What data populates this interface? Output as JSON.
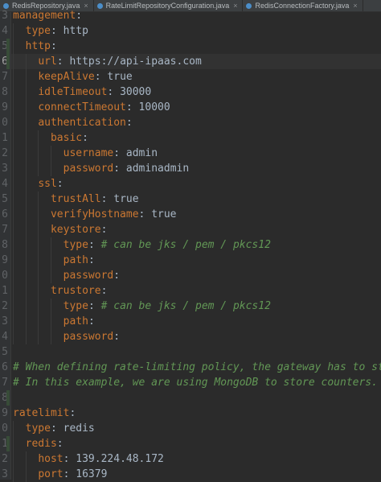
{
  "tabs": [
    {
      "label": "RedisRepository.java",
      "icon": "java-class-icon",
      "icon_color": "#4b8ec9"
    },
    {
      "label": "RateLimitRepositoryConfiguration.java",
      "icon": "java-class-icon",
      "icon_color": "#4b8ec9"
    },
    {
      "label": "RedisConnectionFactory.java",
      "icon": "java-class-icon",
      "icon_color": "#4b8ec9"
    }
  ],
  "gutter": {
    "line_numbers": [
      "3",
      "4",
      "5",
      "6",
      "7",
      "8",
      "9",
      "0",
      "1",
      "2",
      "3",
      "4",
      "5",
      "6",
      "7",
      "8",
      "9",
      "0",
      "1",
      "2",
      "3",
      "4",
      "5",
      "6",
      "7",
      "8",
      "9",
      "0",
      "1",
      "2",
      "3"
    ]
  },
  "code": {
    "lines": [
      {
        "key": "management",
        "sep": ":",
        "value": "",
        "comment": ""
      },
      {
        "key": "type",
        "sep": ": ",
        "value": "http",
        "comment": ""
      },
      {
        "key": "http",
        "sep": ":",
        "value": "",
        "comment": ""
      },
      {
        "key": "url",
        "sep": ": ",
        "value": "https://api-ipaas.com",
        "comment": ""
      },
      {
        "key": "keepAlive",
        "sep": ": ",
        "value": "true",
        "comment": ""
      },
      {
        "key": "idleTimeout",
        "sep": ": ",
        "value": "30000",
        "comment": ""
      },
      {
        "key": "connectTimeout",
        "sep": ": ",
        "value": "10000",
        "comment": ""
      },
      {
        "key": "authentication",
        "sep": ":",
        "value": "",
        "comment": ""
      },
      {
        "key": "basic",
        "sep": ":",
        "value": "",
        "comment": ""
      },
      {
        "key": "username",
        "sep": ": ",
        "value": "admin",
        "comment": ""
      },
      {
        "key": "password",
        "sep": ": ",
        "value": "adminadmin",
        "comment": ""
      },
      {
        "key": "ssl",
        "sep": ":",
        "value": "",
        "comment": ""
      },
      {
        "key": "trustAll",
        "sep": ": ",
        "value": "true",
        "comment": ""
      },
      {
        "key": "verifyHostname",
        "sep": ": ",
        "value": "true",
        "comment": ""
      },
      {
        "key": "keystore",
        "sep": ":",
        "value": "",
        "comment": ""
      },
      {
        "key": "type",
        "sep": ": ",
        "value": "",
        "comment": "# can be jks / pem / pkcs12"
      },
      {
        "key": "path",
        "sep": ":",
        "value": "",
        "comment": ""
      },
      {
        "key": "password",
        "sep": ":",
        "value": "",
        "comment": ""
      },
      {
        "key": "trustore",
        "sep": ":",
        "value": "",
        "comment": ""
      },
      {
        "key": "type",
        "sep": ": ",
        "value": "",
        "comment": "# can be jks / pem / pkcs12"
      },
      {
        "key": "path",
        "sep": ":",
        "value": "",
        "comment": ""
      },
      {
        "key": "password",
        "sep": ":",
        "value": "",
        "comment": ""
      },
      {
        "key": "",
        "sep": "",
        "value": "",
        "comment": ""
      },
      {
        "key": "",
        "sep": "",
        "value": "",
        "comment": "# When defining rate-limiting policy, the gateway has to sto"
      },
      {
        "key": "",
        "sep": "",
        "value": "",
        "comment": "# In this example, we are using MongoDB to store counters."
      },
      {
        "key": "",
        "sep": "",
        "value": "",
        "comment": ""
      },
      {
        "key": "ratelimit",
        "sep": ":",
        "value": "",
        "comment": ""
      },
      {
        "key": "type",
        "sep": ": ",
        "value": "redis",
        "comment": ""
      },
      {
        "key": "redis",
        "sep": ":",
        "value": "",
        "comment": ""
      },
      {
        "key": "host",
        "sep": ": ",
        "value": "139.224.48.172",
        "comment": ""
      },
      {
        "key": "port",
        "sep": ": ",
        "value": "16379",
        "comment": ""
      }
    ]
  },
  "colors": {
    "key": "#cc7832",
    "value": "#a9b7c6",
    "comment": "#629755",
    "background": "#2b2b2b"
  }
}
